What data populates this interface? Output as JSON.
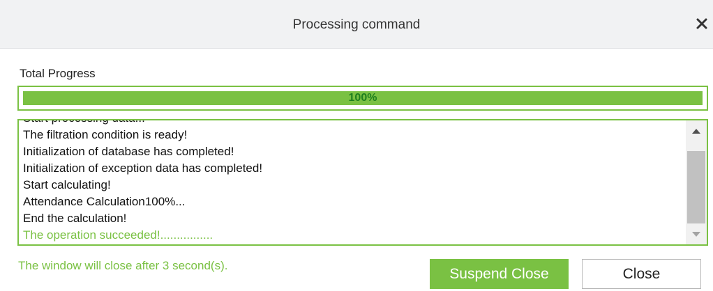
{
  "dialog": {
    "title": "Processing command",
    "close_icon": "close-icon"
  },
  "progress": {
    "label": "Total Progress",
    "percent_text": "100%",
    "fraction": 1.0
  },
  "log": {
    "lines": [
      {
        "text": "Start processing data...",
        "status": "normal"
      },
      {
        "text": "The filtration condition is ready!",
        "status": "normal"
      },
      {
        "text": "Initialization of database has completed!",
        "status": "normal"
      },
      {
        "text": "Initialization of exception data has completed!",
        "status": "normal"
      },
      {
        "text": "Start calculating!",
        "status": "normal"
      },
      {
        "text": "Attendance Calculation100%...",
        "status": "normal"
      },
      {
        "text": "End the calculation!",
        "status": "normal"
      },
      {
        "text": "The operation succeeded!................",
        "status": "success"
      }
    ]
  },
  "footer": {
    "countdown_text": "The window will close after 3 second(s).",
    "suspend_close_label": "Suspend Close",
    "close_label": "Close"
  },
  "colors": {
    "accent": "#7ac143",
    "progress_text": "#1e7f1e",
    "titlebar_bg": "#f1f2f3"
  }
}
